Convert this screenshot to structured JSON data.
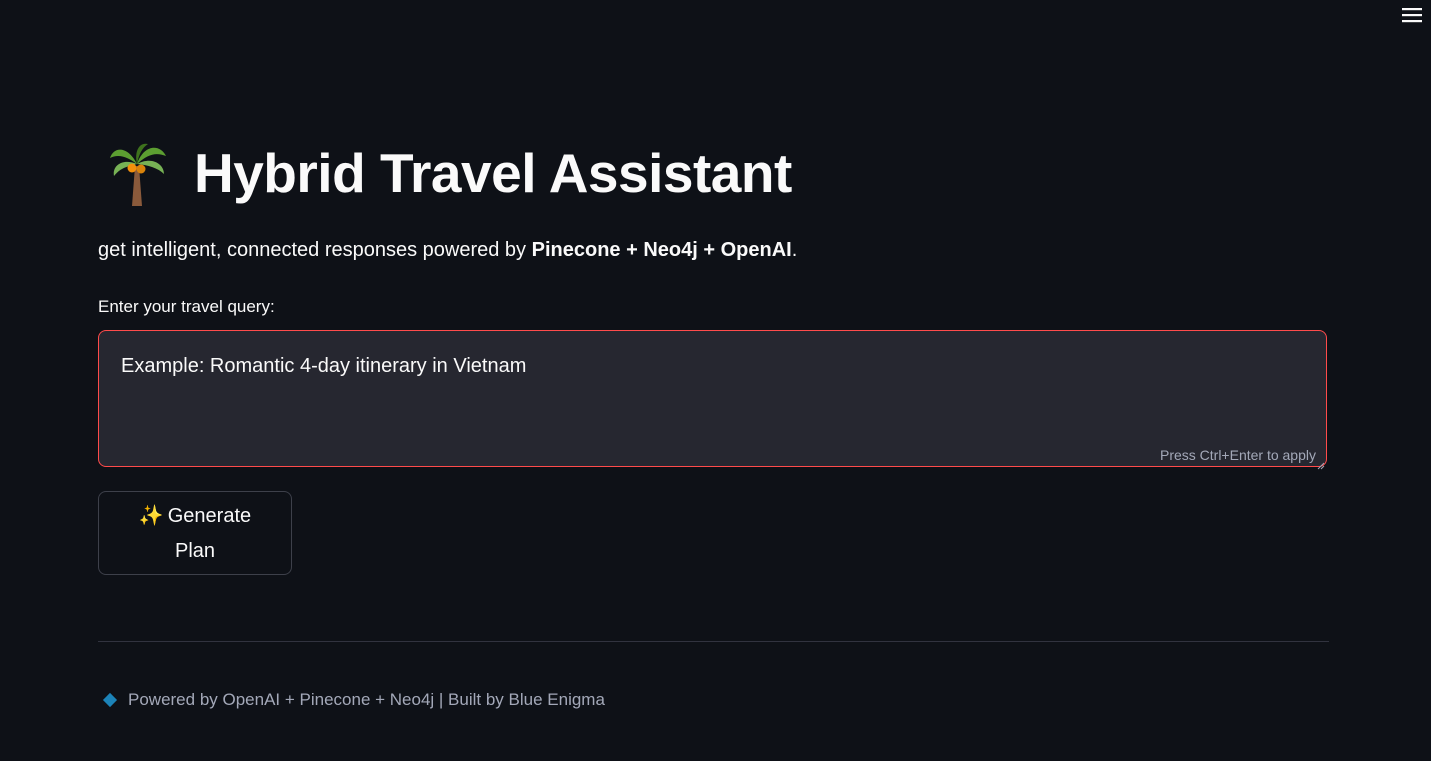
{
  "header": {
    "menu_icon": "hamburger-menu-icon"
  },
  "main": {
    "title_icon": "palm-tree-icon",
    "title": "Hybrid Travel Assistant",
    "subtitle_prefix": "get intelligent, connected responses powered by ",
    "subtitle_bold": "Pinecone + Neo4j + OpenAI",
    "subtitle_suffix": ".",
    "query_label": "Enter your travel query:",
    "query_value": "Example: Romantic 4-day itinerary in Vietnam",
    "query_hint": "Press Ctrl+Enter to apply",
    "generate_icon": "sparkles-icon",
    "generate_label": "Generate Plan"
  },
  "footer": {
    "icon": "blue-diamond-icon",
    "text": "Powered by OpenAI + Pinecone + Neo4j | Built by Blue Enigma"
  },
  "colors": {
    "background": "#0e1117",
    "input_background": "#262730",
    "input_border_focus": "#ff4b4b",
    "text": "#fafafa",
    "muted_text": "#a3a8b8",
    "divider": "#31333f",
    "diamond": "#1c83b8"
  }
}
